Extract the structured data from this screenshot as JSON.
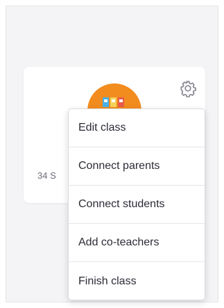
{
  "class_card": {
    "student_count": "34 S"
  },
  "icons": {
    "settings": "gear-icon",
    "avatar": "class-avatar-icon"
  },
  "colors": {
    "avatar": "#f28c1e",
    "panel_bg": "#f4f4f6",
    "text": "#2b2b36"
  },
  "menu": {
    "items": [
      {
        "label": "Edit class"
      },
      {
        "label": "Connect parents"
      },
      {
        "label": "Connect students"
      },
      {
        "label": "Add co-teachers"
      },
      {
        "label": "Finish class"
      }
    ]
  }
}
